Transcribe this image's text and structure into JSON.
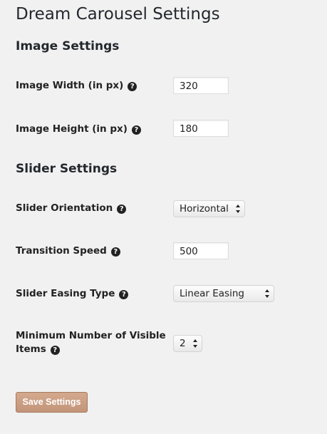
{
  "page": {
    "title": "Dream Carousel Settings"
  },
  "image_settings": {
    "heading": "Image Settings",
    "width": {
      "label": "Image Width (in px)",
      "value": "320",
      "help_icon": "question-circle-icon"
    },
    "height": {
      "label": "Image Height (in px)",
      "value": "180",
      "help_icon": "question-circle-icon"
    }
  },
  "slider_settings": {
    "heading": "Slider Settings",
    "orientation": {
      "label": "Slider Orientation",
      "selected": "Horizontal",
      "help_icon": "question-circle-icon"
    },
    "transition_speed": {
      "label": "Transition Speed",
      "value": "500",
      "help_icon": "question-circle-icon"
    },
    "easing_type": {
      "label": "Slider Easing Type",
      "selected": "Linear Easing",
      "help_icon": "question-circle-icon"
    },
    "visible_items": {
      "label_line1": "Minimum Number of Visible",
      "label_line2": "Items",
      "selected": "2",
      "help_icon": "question-circle-icon"
    }
  },
  "actions": {
    "save_label": "Save Settings"
  },
  "colors": {
    "background": "#f1f1f1",
    "save_button": "#c99e82",
    "help_icon": "#222222"
  },
  "icons": {
    "help_glyph": "?"
  }
}
